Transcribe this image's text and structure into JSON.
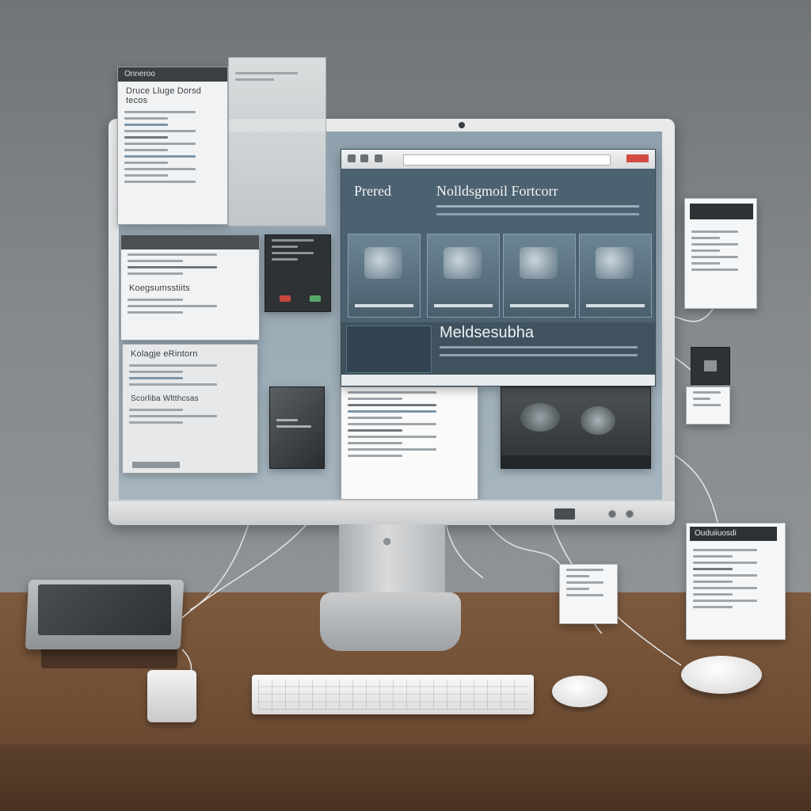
{
  "scene": {
    "description_free": true
  },
  "windows": {
    "top_left": {
      "title": "Onneroo",
      "heading": "Druce Lluge Dorsd tecos"
    },
    "mid_left": {
      "heading": "Koegsumsstiits"
    },
    "lower_left": {
      "heading": "Kolagje eRintorn",
      "subheading": "Scorliba Wltthcsas"
    }
  },
  "app": {
    "title": "Prered",
    "header": "Nolldsgmoil Fortcorr",
    "section": "Meldsesubha"
  },
  "side_cards": {
    "top_right": {
      "label": ""
    },
    "bottom_right": {
      "label": "Ouduiiuosdi"
    }
  },
  "colors": {
    "wall": "#7c8184",
    "desk": "#6d4c33",
    "app_bg": "#4d6270",
    "accent_red": "#d24b3e"
  },
  "icons": [
    "apple-logo-icon",
    "camera-icon"
  ]
}
